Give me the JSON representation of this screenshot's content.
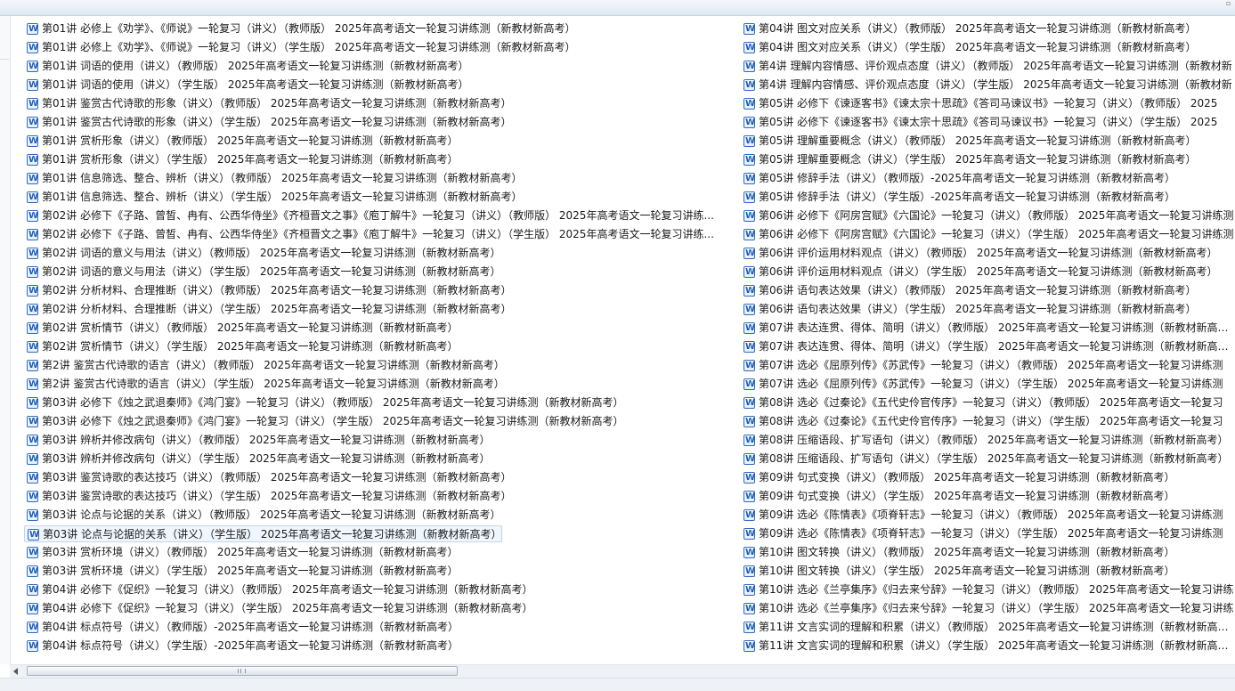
{
  "files": {
    "left_column": [
      "第01讲 必修上《劝学》、《师说》一轮复习（讲义）（教师版） 2025年高考语文一轮复习讲练测（新教材新高考）",
      "第01讲 必修上《劝学》、《师说》一轮复习（讲义）（学生版） 2025年高考语文一轮复习讲练测（新教材新高考）",
      "第01讲 词语的使用（讲义）（教师版） 2025年高考语文一轮复习讲练测（新教材新高考）",
      "第01讲 词语的使用（讲义）（学生版） 2025年高考语文一轮复习讲练测（新教材新高考）",
      "第01讲 鉴赏古代诗歌的形象（讲义）（教师版） 2025年高考语文一轮复习讲练测（新教材新高考）",
      "第01讲 鉴赏古代诗歌的形象（讲义）（学生版） 2025年高考语文一轮复习讲练测（新教材新高考）",
      "第01讲 赏析形象（讲义）（教师版） 2025年高考语文一轮复习讲练测（新教材新高考）",
      "第01讲 赏析形象（讲义）（学生版） 2025年高考语文一轮复习讲练测（新教材新高考）",
      "第01讲 信息筛选、整合、辨析（讲义）（教师版） 2025年高考语文一轮复习讲练测（新教材新高考）",
      "第01讲 信息筛选、整合、辨析（讲义）（学生版） 2025年高考语文一轮复习讲练测（新教材新高考）",
      "第02讲 必修下《子路、曾皙、冉有、公西华侍坐》《齐桓晋文之事》《庖丁解牛》一轮复习（讲义）（教师版） 2025年高考语文一轮复习讲练...",
      "第02讲 必修下《子路、曾皙、冉有、公西华侍坐》《齐桓晋文之事》《庖丁解牛》一轮复习（讲义）（学生版） 2025年高考语文一轮复习讲练...",
      "第02讲 词语的意义与用法（讲义）（教师版） 2025年高考语文一轮复习讲练测（新教材新高考）",
      "第02讲 词语的意义与用法（讲义）（学生版） 2025年高考语文一轮复习讲练测（新教材新高考）",
      "第02讲 分析材料、合理推断（讲义）（教师版） 2025年高考语文一轮复习讲练测（新教材新高考）",
      "第02讲 分析材料、合理推断（讲义）（学生版） 2025年高考语文一轮复习讲练测（新教材新高考）",
      "第02讲 赏析情节（讲义）（教师版） 2025年高考语文一轮复习讲练测（新教材新高考）",
      "第02讲 赏析情节（讲义）（学生版） 2025年高考语文一轮复习讲练测（新教材新高考）",
      "第2讲 鉴赏古代诗歌的语言（讲义）（教师版） 2025年高考语文一轮复习讲练测（新教材新高考）",
      "第2讲 鉴赏古代诗歌的语言（讲义）（学生版） 2025年高考语文一轮复习讲练测（新教材新高考）",
      "第03讲 必修下《烛之武退秦师》《鸿门宴》一轮复习（讲义）（教师版） 2025年高考语文一轮复习讲练测（新教材新高考）",
      "第03讲 必修下《烛之武退秦师》《鸿门宴》一轮复习（讲义）（学生版） 2025年高考语文一轮复习讲练测（新教材新高考）",
      "第03讲 辨析并修改病句（讲义）（教师版） 2025年高考语文一轮复习讲练测（新教材新高考）",
      "第03讲 辨析并修改病句（讲义）（学生版） 2025年高考语文一轮复习讲练测（新教材新高考）",
      "第03讲 鉴赏诗歌的表达技巧（讲义）（教师版） 2025年高考语文一轮复习讲练测（新教材新高考）",
      "第03讲 鉴赏诗歌的表达技巧（讲义）（学生版） 2025年高考语文一轮复习讲练测（新教材新高考）",
      "第03讲 论点与论据的关系（讲义）（教师版） 2025年高考语文一轮复习讲练测（新教材新高考）",
      "第03讲 论点与论据的关系（讲义）（学生版） 2025年高考语文一轮复习讲练测（新教材新高考）",
      "第03讲 赏析环境（讲义）（教师版） 2025年高考语文一轮复习讲练测（新教材新高考）",
      "第03讲 赏析环境（讲义）（学生版） 2025年高考语文一轮复习讲练测（新教材新高考）",
      "第04讲 必修下《促织》一轮复习（讲义）（教师版） 2025年高考语文一轮复习讲练测（新教材新高考）",
      "第04讲 必修下《促织》一轮复习（讲义）（学生版） 2025年高考语文一轮复习讲练测（新教材新高考）",
      "第04讲 标点符号（讲义）（教师版）-2025年高考语文一轮复习讲练测（新教材新高考）",
      "第04讲 标点符号（讲义）（学生版）-2025年高考语文一轮复习讲练测（新教材新高考）"
    ],
    "right_column": [
      "第04讲 图文对应关系（讲义）（教师版） 2025年高考语文一轮复习讲练测（新教材新高考）",
      "第04讲 图文对应关系（讲义）（学生版） 2025年高考语文一轮复习讲练测（新教材新高考）",
      "第4讲 理解内容情感、评价观点态度（讲义）（教师版） 2025年高考语文一轮复习讲练测（新教材新",
      "第4讲 理解内容情感、评价观点态度（讲义）（学生版） 2025年高考语文一轮复习讲练测（新教材新",
      "第05讲 必修下《谏逐客书》《谏太宗十思疏》《答司马谏议书》一轮复习（讲义）（教师版） 2025",
      "第05讲 必修下《谏逐客书》《谏太宗十思疏》《答司马谏议书》一轮复习（讲义）（学生版） 2025",
      "第05讲 理解重要概念（讲义）（教师版） 2025年高考语文一轮复习讲练测（新教材新高考）",
      "第05讲 理解重要概念（讲义）（学生版） 2025年高考语文一轮复习讲练测（新教材新高考）",
      "第05讲 修辞手法（讲义）（教师版）-2025年高考语文一轮复习讲练测（新教材新高考）",
      "第05讲 修辞手法（讲义）（学生版）-2025年高考语文一轮复习讲练测（新教材新高考）",
      "第06讲 必修下《阿房宫赋》《六国论》一轮复习（讲义）（教师版） 2025年高考语文一轮复习讲练测",
      "第06讲 必修下《阿房宫赋》《六国论》一轮复习（讲义）（学生版） 2025年高考语文一轮复习讲练测",
      "第06讲 评价运用材料观点（讲义）（教师版） 2025年高考语文一轮复习讲练测（新教材新高考）",
      "第06讲 评价运用材料观点（讲义）（学生版） 2025年高考语文一轮复习讲练测（新教材新高考）",
      "第06讲 语句表达效果（讲义）（教师版） 2025年高考语文一轮复习讲练测（新教材新高考）",
      "第06讲 语句表达效果（讲义）（学生版） 2025年高考语文一轮复习讲练测（新教材新高考）",
      "第07讲 表达连贯、得体、简明（讲义）（教师版） 2025年高考语文一轮复习讲练测（新教材新高考）",
      "第07讲 表达连贯、得体、简明（讲义）（学生版） 2025年高考语文一轮复习讲练测（新教材新高考）",
      "第07讲 选必《屈原列传》《苏武传》一轮复习（讲义）（教师版） 2025年高考语文一轮复习讲练测",
      "第07讲 选必《屈原列传》《苏武传》一轮复习（讲义）（学生版） 2025年高考语文一轮复习讲练测",
      "第08讲 选必《过秦论》《五代史伶官传序》一轮复习（讲义）（教师版） 2025年高考语文一轮复习",
      "第08讲 选必《过秦论》《五代史伶官传序》一轮复习（讲义）（学生版） 2025年高考语文一轮复习",
      "第08讲 压缩语段、扩写语句（讲义）（教师版） 2025年高考语文一轮复习讲练测（新教材新高考）",
      "第08讲 压缩语段、扩写语句（讲义）（学生版） 2025年高考语文一轮复习讲练测（新教材新高考）",
      "第09讲 句式变换（讲义）（教师版） 2025年高考语文一轮复习讲练测（新教材新高考）",
      "第09讲 句式变换（讲义）（学生版） 2025年高考语文一轮复习讲练测（新教材新高考）",
      "第09讲 选必《陈情表》《项脊轩志》一轮复习（讲义）（教师版） 2025年高考语文一轮复习讲练测",
      "第09讲 选必《陈情表》《项脊轩志》一轮复习（讲义）（学生版） 2025年高考语文一轮复习讲练测",
      "第10讲 图文转换（讲义）（教师版） 2025年高考语文一轮复习讲练测（新教材新高考）",
      "第10讲 图文转换（讲义）（学生版） 2025年高考语文一轮复习讲练测（新教材新高考）",
      "第10讲 选必《兰亭集序》《归去来兮辞》一轮复习（讲义）（教师版） 2025年高考语文一轮复习讲练",
      "第10讲 选必《兰亭集序》《归去来兮辞》一轮复习（讲义）（学生版） 2025年高考语文一轮复习讲练",
      "第11讲 文言实词的理解和积累（讲义）（教师版） 2025年高考语文一轮复习讲练测（新教材新高考）",
      "第11讲 文言实词的理解和积累（讲义）（学生版） 2025年高考语文一轮复习讲练测（新教材新高考）"
    ],
    "selected": {
      "column": "left_column",
      "index": 27
    },
    "icon": "word-document-icon",
    "accent_color": "#2b6cc4"
  }
}
